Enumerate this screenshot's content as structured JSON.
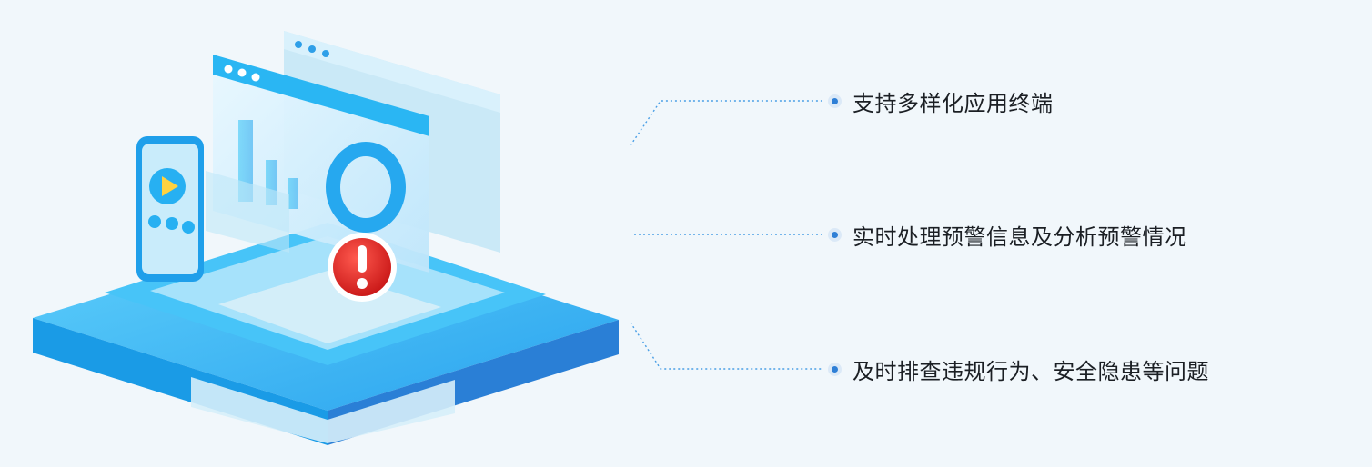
{
  "features": [
    {
      "label": "支持多样化应用终端",
      "icon": "dot-bullet-icon"
    },
    {
      "label": "实时处理预警信息及分析预警情况",
      "icon": "dot-bullet-icon"
    },
    {
      "label": "及时排查违规行为、安全隐患等问题",
      "icon": "dot-bullet-icon"
    }
  ],
  "illustration": {
    "alert_symbol": "!",
    "colors": {
      "accent": "#1fb2f2",
      "platform": "#2aa8ee",
      "alert": "#e52b2b",
      "connector": "#4a9fe6"
    }
  }
}
